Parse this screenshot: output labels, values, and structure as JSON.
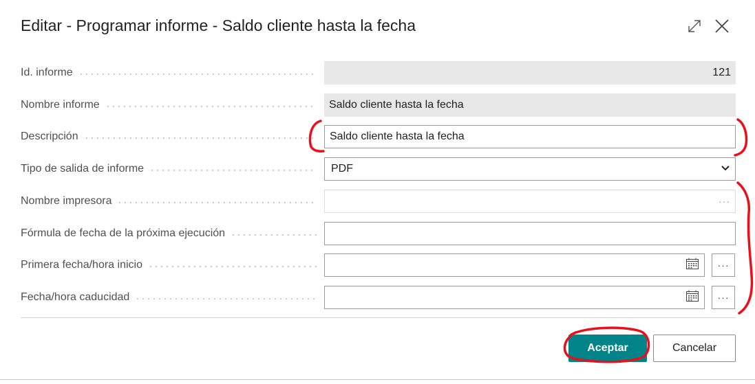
{
  "dialog": {
    "title": "Editar - Programar informe - Saldo cliente hasta la fecha",
    "header_icons": [
      "expand-icon",
      "close-icon"
    ]
  },
  "fields": {
    "report_id": {
      "label": "Id. informe",
      "value": "121"
    },
    "report_name": {
      "label": "Nombre informe",
      "value": "Saldo cliente hasta la fecha"
    },
    "description": {
      "label": "Descripción",
      "value": "Saldo cliente hasta la fecha"
    },
    "output_type": {
      "label": "Tipo de salida de informe",
      "value": "PDF"
    },
    "printer_name": {
      "label": "Nombre impresora",
      "value": "",
      "assist": "···"
    },
    "next_run_formula": {
      "label": "Fórmula de fecha de la próxima ejecución",
      "value": ""
    },
    "first_start": {
      "label": "Primera fecha/hora inicio",
      "value": "",
      "assist": "···"
    },
    "expiration": {
      "label": "Fecha/hora caducidad",
      "value": "",
      "assist": "···"
    }
  },
  "buttons": {
    "ok": "Aceptar",
    "cancel": "Cancelar"
  },
  "colors": {
    "accent": "#008489",
    "annotation": "#e8101a",
    "readonly_bg": "#e8e8e8"
  }
}
